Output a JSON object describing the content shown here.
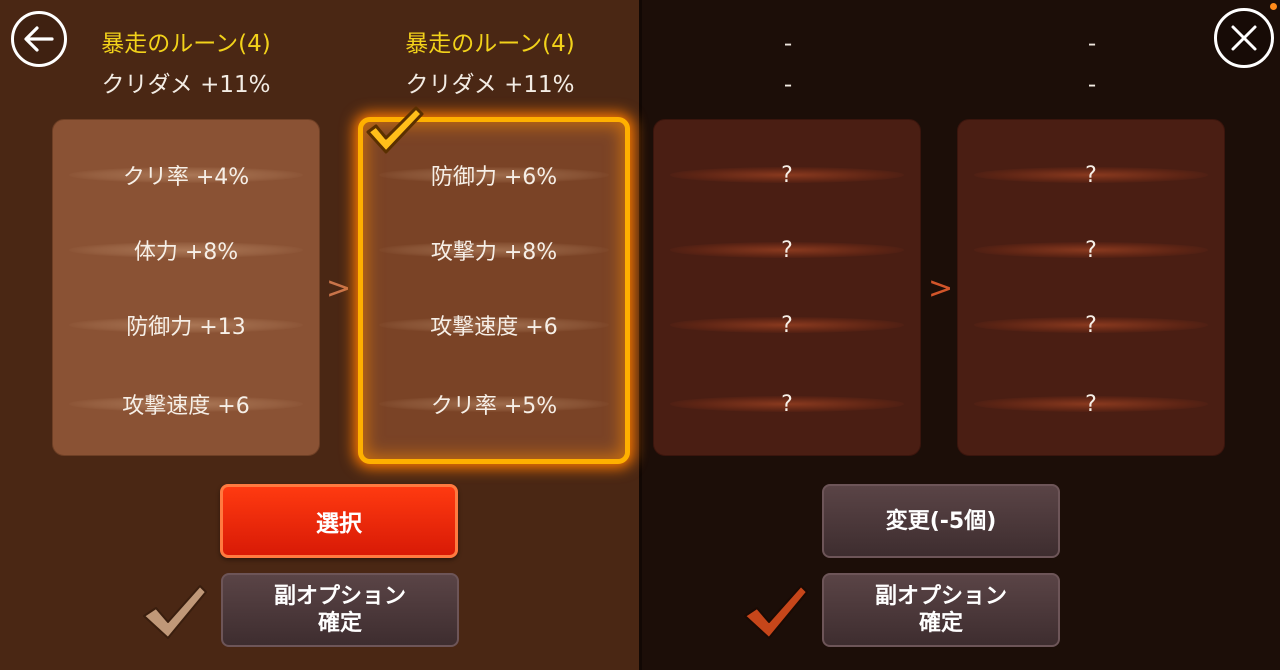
{
  "colors": {
    "rune_name": "#f2d21a",
    "select_button": "#e8240a",
    "checkmark_gold": "#ffb000",
    "checkmark_tan": "#c09878",
    "checkmark_orange": "#c6461a"
  },
  "icons": {
    "back": "back-arrow-icon",
    "close": "close-icon",
    "check": "checkmark-icon"
  },
  "columns": [
    {
      "rune_name": "暴走のルーン(4)",
      "main_stat": "クリダメ +11%",
      "sub_stats": [
        "クリ率 +4%",
        "体力 +8%",
        "防御力 +13",
        "攻撃速度 +6"
      ],
      "selected": false
    },
    {
      "rune_name": "暴走のルーン(4)",
      "main_stat": "クリダメ +11%",
      "sub_stats": [
        "防御力 +6%",
        "攻撃力 +8%",
        "攻撃速度 +6",
        "クリ率 +5%"
      ],
      "selected": true
    },
    {
      "rune_name": "-",
      "main_stat": "-",
      "sub_stats": [
        "?",
        "?",
        "?",
        "?"
      ],
      "selected": false
    },
    {
      "rune_name": "-",
      "main_stat": "-",
      "sub_stats": [
        "?",
        "?",
        "?",
        "?"
      ],
      "selected": false
    }
  ],
  "separator": ">",
  "buttons": {
    "select": "選択",
    "change": "変更(-5個)",
    "confirm_left_line1": "副オプション",
    "confirm_left_line2": "確定",
    "confirm_right_line1": "副オプション",
    "confirm_right_line2": "確定"
  }
}
